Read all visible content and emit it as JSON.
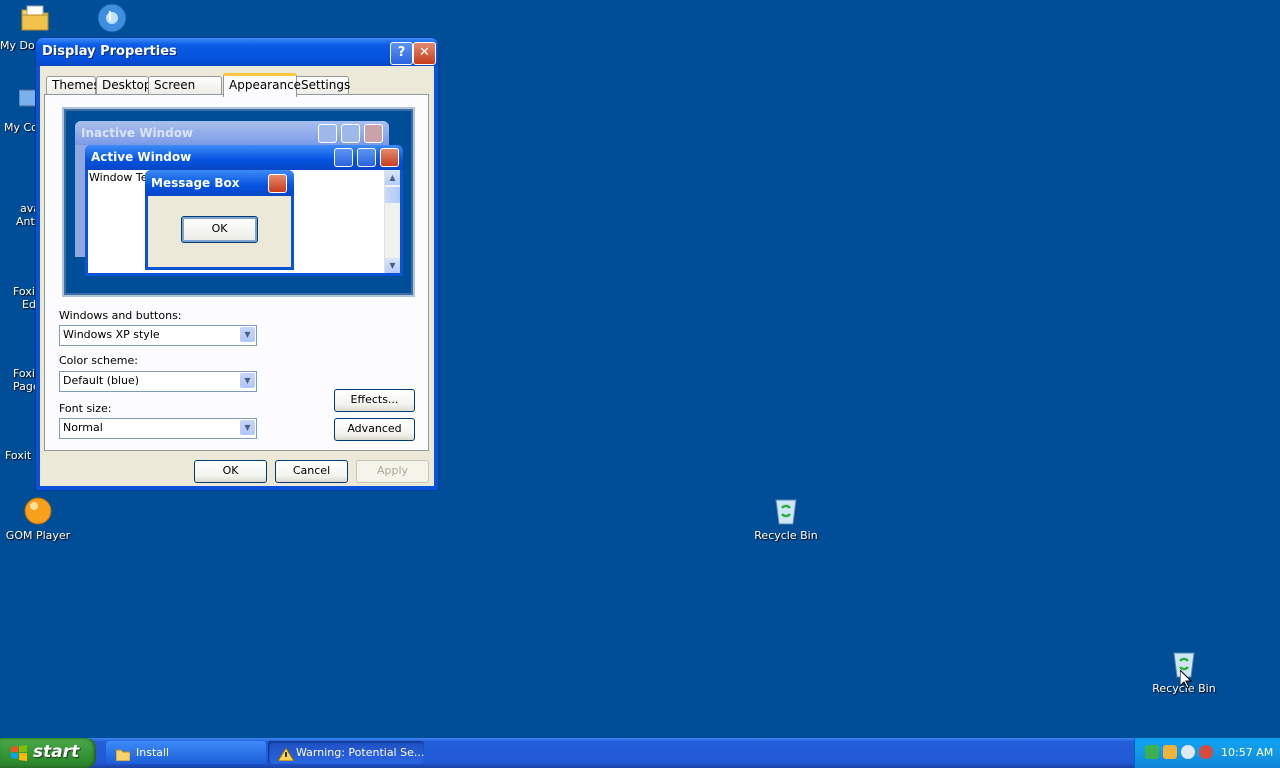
{
  "desktop": {
    "icons": [
      {
        "name": "my-documents",
        "label": "My Doc"
      },
      {
        "name": "media",
        "label": ""
      },
      {
        "name": "my-computer",
        "label": "My Co"
      },
      {
        "name": "avast",
        "label": "ava",
        "label2": "Anti"
      },
      {
        "name": "foxit-editor",
        "label": "Foxi",
        "label2": "Ed"
      },
      {
        "name": "foxit-page",
        "label": "Foxi",
        "label2": "Page"
      },
      {
        "name": "foxit-reader",
        "label": "Foxit F"
      },
      {
        "name": "gom-player",
        "label": "GOM Player"
      },
      {
        "name": "recycle-bin-1",
        "label": "Recycle Bin"
      },
      {
        "name": "recycle-bin-2",
        "label": "Recycle Bin"
      }
    ]
  },
  "dialog": {
    "title": "Display Properties",
    "help_glyph": "?",
    "close_glyph": "✕",
    "tabs": [
      "Themes",
      "Desktop",
      "Screen Saver",
      "Appearance",
      "Settings"
    ],
    "active_tab": "Appearance",
    "preview": {
      "inactive_title": "Inactive Window",
      "active_title": "Active Window",
      "window_text": "Window Text",
      "message_title": "Message Box",
      "ok_label": "OK"
    },
    "windows_buttons_label": "Windows and buttons:",
    "windows_buttons_value": "Windows XP style",
    "color_scheme_label": "Color scheme:",
    "color_scheme_value": "Default (blue)",
    "font_size_label": "Font size:",
    "font_size_value": "Normal",
    "effects_label": "Effects...",
    "advanced_label": "Advanced",
    "ok_label": "OK",
    "cancel_label": "Cancel",
    "apply_label": "Apply"
  },
  "taskbar": {
    "start_label": "start",
    "tasks": [
      {
        "label": "Install",
        "icon": "folder-icon"
      },
      {
        "label": "Warning: Potential Se...",
        "icon": "warning-icon"
      }
    ],
    "clock": "10:57 AM"
  },
  "colors": {
    "desktop_bg": "#004e98",
    "title_blue": "#0553e0",
    "dialog_bg": "#ece9d8",
    "start_green": "#3c9a3c"
  }
}
